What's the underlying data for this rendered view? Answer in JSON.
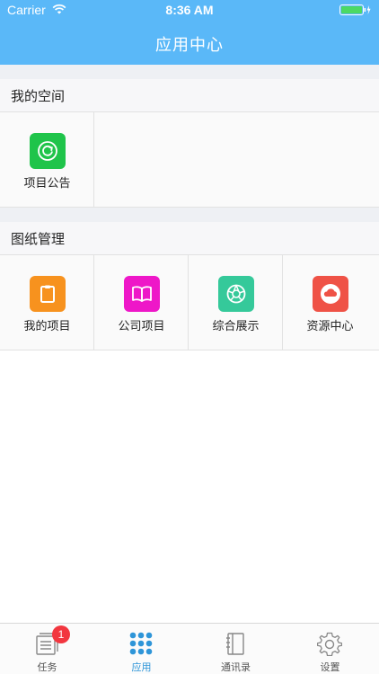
{
  "status_bar": {
    "carrier": "Carrier",
    "time": "8:36 AM"
  },
  "header": {
    "title": "应用中心",
    "color": "#5ab8f8"
  },
  "sections": [
    {
      "title": "我的空间",
      "items": [
        {
          "label": "项目公告",
          "icon": "refresh-circle-icon",
          "color": "#1fc44a"
        }
      ]
    },
    {
      "title": "图纸管理",
      "items": [
        {
          "label": "我的项目",
          "icon": "clipboard-icon",
          "color": "#f7921e"
        },
        {
          "label": "公司项目",
          "icon": "open-book-icon",
          "color": "#ee17c8"
        },
        {
          "label": "综合展示",
          "icon": "aperture-icon",
          "color": "#35c99a"
        },
        {
          "label": "资源中心",
          "icon": "cloud-icon",
          "color": "#ef5246"
        }
      ]
    }
  ],
  "tabbar": {
    "tabs": [
      {
        "label": "任务",
        "icon": "document-list-icon",
        "badge": "1",
        "active": false
      },
      {
        "label": "应用",
        "icon": "grid-dots-icon",
        "active": true
      },
      {
        "label": "通讯录",
        "icon": "address-book-icon",
        "active": false
      },
      {
        "label": "设置",
        "icon": "gear-icon",
        "active": false
      }
    ],
    "active_color": "#2e95d8"
  }
}
